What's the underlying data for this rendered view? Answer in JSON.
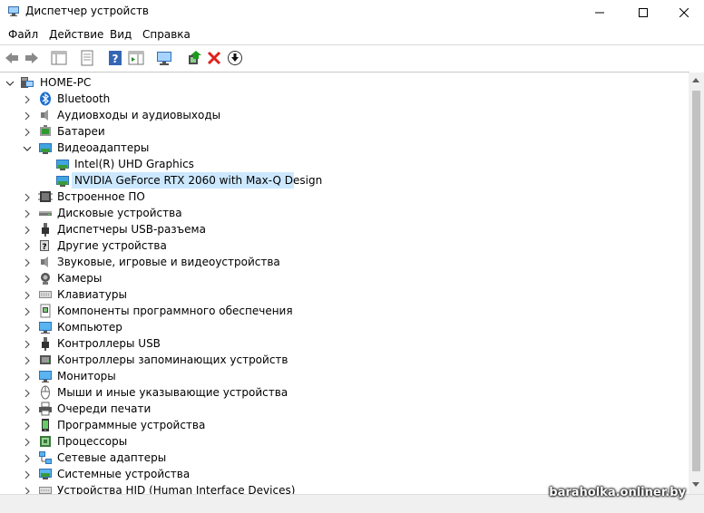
{
  "window": {
    "title": "Диспетчер устройств"
  },
  "menu": {
    "items": [
      "Файл",
      "Действие",
      "Вид",
      "Справка"
    ]
  },
  "tree": {
    "root": "HOME-PC",
    "categories": [
      {
        "label": "Bluetooth",
        "icon": "bluetooth-icon",
        "expanded": false
      },
      {
        "label": "Аудиовходы и аудиовыходы",
        "icon": "speaker-icon",
        "expanded": false
      },
      {
        "label": "Батареи",
        "icon": "battery-icon",
        "expanded": false
      },
      {
        "label": "Видеоадаптеры",
        "icon": "display-adapter-icon",
        "expanded": true,
        "children": [
          "Intel(R) UHD Graphics",
          "NVIDIA GeForce RTX 2060 with Max-Q Design"
        ]
      },
      {
        "label": "Встроенное ПО",
        "icon": "firmware-icon",
        "expanded": false
      },
      {
        "label": "Дисковые устройства",
        "icon": "disk-icon",
        "expanded": false
      },
      {
        "label": "Диспетчеры USB-разъема",
        "icon": "usb-icon",
        "expanded": false
      },
      {
        "label": "Другие устройства",
        "icon": "unknown-device-icon",
        "expanded": false
      },
      {
        "label": "Звуковые, игровые и видеоустройства",
        "icon": "speaker-icon",
        "expanded": false
      },
      {
        "label": "Камеры",
        "icon": "camera-icon",
        "expanded": false
      },
      {
        "label": "Клавиатуры",
        "icon": "keyboard-icon",
        "expanded": false
      },
      {
        "label": "Компоненты программного обеспечения",
        "icon": "software-component-icon",
        "expanded": false
      },
      {
        "label": "Компьютер",
        "icon": "computer-icon",
        "expanded": false
      },
      {
        "label": "Контроллеры USB",
        "icon": "usb-icon",
        "expanded": false
      },
      {
        "label": "Контроллеры запоминающих устройств",
        "icon": "storage-controller-icon",
        "expanded": false
      },
      {
        "label": "Мониторы",
        "icon": "monitor-icon",
        "expanded": false
      },
      {
        "label": "Мыши и иные указывающие устройства",
        "icon": "mouse-icon",
        "expanded": false
      },
      {
        "label": "Очереди печати",
        "icon": "printer-icon",
        "expanded": false
      },
      {
        "label": "Программные устройства",
        "icon": "software-device-icon",
        "expanded": false
      },
      {
        "label": "Процессоры",
        "icon": "processor-icon",
        "expanded": false
      },
      {
        "label": "Сетевые адаптеры",
        "icon": "network-adapter-icon",
        "expanded": false
      },
      {
        "label": "Системные устройства",
        "icon": "system-device-icon",
        "expanded": false
      },
      {
        "label": "Устройства HID (Human Interface Devices)",
        "icon": "hid-icon",
        "expanded": false
      }
    ],
    "selected": "NVIDIA GeForce RTX 2060 with Max-Q Design"
  },
  "watermark": "baraholka.onliner.by",
  "colors": {
    "selection": "#cce8ff",
    "accent": "#0078d7"
  }
}
